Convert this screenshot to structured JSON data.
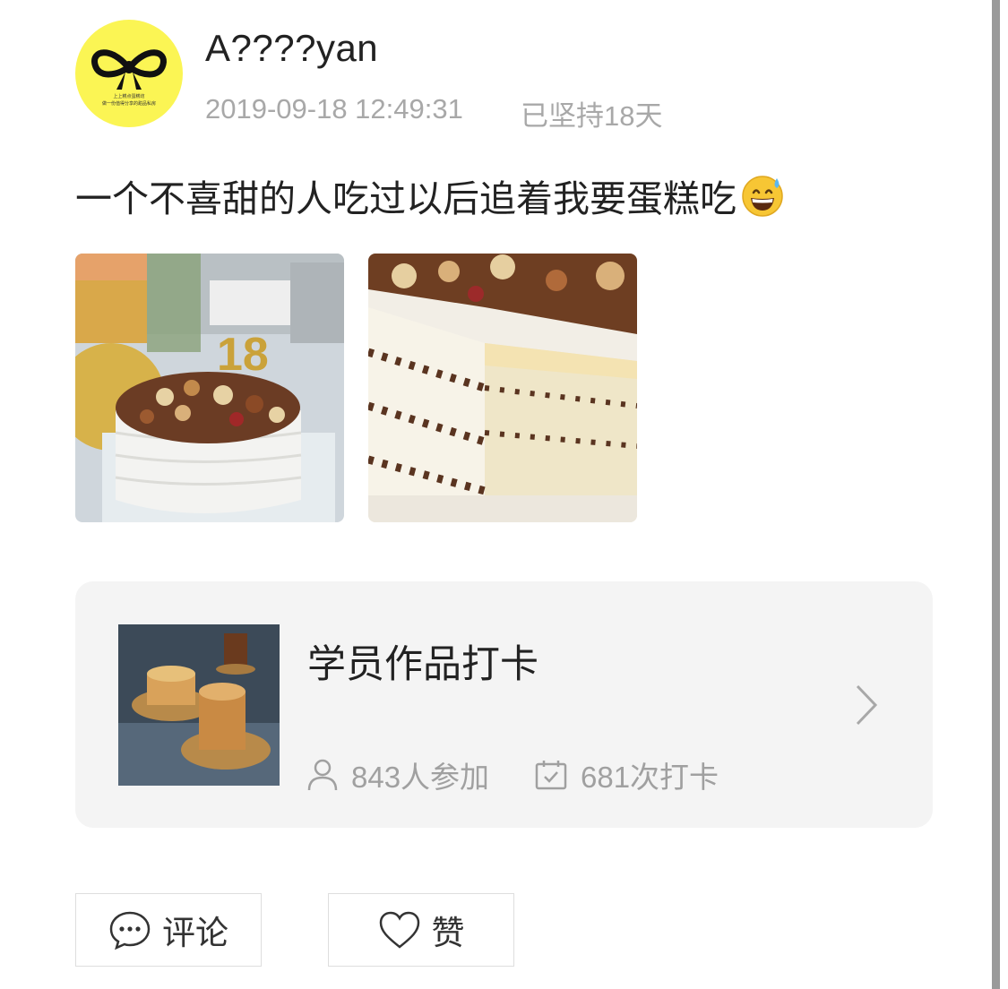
{
  "post": {
    "author": {
      "name": "A????yan",
      "avatar_icon": "bow-logo-icon",
      "avatar_caption_line1": "上上糕点蛋糕坊",
      "avatar_caption_line2": "做一份值得分享的甜品私房"
    },
    "timestamp": "2019-09-18 12:49:31",
    "streak": "已坚持18天",
    "text": "一个不喜甜的人吃过以后追着我要蛋糕吃",
    "emoji": "grinning-sweat-emoji",
    "photos": [
      {
        "name": "cake-photo-1",
        "candle_number": "18"
      },
      {
        "name": "cake-photo-2"
      }
    ]
  },
  "activity_card": {
    "title": "学员作品打卡",
    "participants": "843人参加",
    "checkins": "681次打卡",
    "icons": {
      "participants": "person-icon",
      "checkins": "calendar-check-icon",
      "open": "chevron-right-icon"
    }
  },
  "actions": {
    "comment_label": "评论",
    "like_label": "赞",
    "icons": {
      "comment": "comment-bubble-icon",
      "like": "heart-icon"
    }
  },
  "colors": {
    "avatar_bg": "#fbf554",
    "secondary_text": "#a8a8a8",
    "card_bg": "#f4f4f4"
  }
}
